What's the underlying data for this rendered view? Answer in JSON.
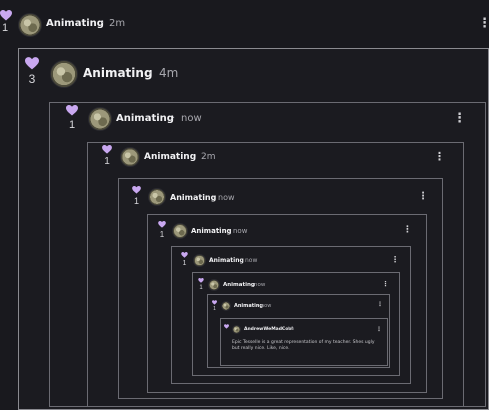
{
  "colors": {
    "background": "#19191e",
    "heart": "#c9a8f0",
    "frame_border": "#6b6b72"
  },
  "icons": {
    "like": "heart-icon",
    "menu": "kebab-menu-icon"
  },
  "comments": [
    {
      "likes": "1",
      "user": "Animating",
      "sep": "·",
      "time": "2m"
    },
    {
      "likes": "3",
      "user": "Animating",
      "sep": "·",
      "time": "4m"
    },
    {
      "likes": "1",
      "user": "Animating",
      "sep": "·",
      "time": "now"
    },
    {
      "likes": "1",
      "user": "Animating",
      "sep": "·",
      "time": "2m"
    },
    {
      "likes": "1",
      "user": "Animating",
      "sep": "·",
      "time": "now"
    },
    {
      "likes": "1",
      "user": "Animating",
      "sep": "·",
      "time": "now"
    },
    {
      "likes": "1",
      "user": "Animating",
      "sep": "·",
      "time": "now"
    },
    {
      "likes": "1",
      "user": "Animating",
      "sep": "·",
      "time": "now"
    },
    {
      "likes": "1",
      "user": "Animating",
      "sep": "·",
      "time": "now"
    },
    {
      "likes": "",
      "user": "AndrewWeMadCool",
      "sep": "·",
      "time": "4m",
      "text": "Epic Tesselle is a great representation of my teacher. Shes ugly but really nice. Like, nice."
    }
  ],
  "menu_glyph": "⋮"
}
